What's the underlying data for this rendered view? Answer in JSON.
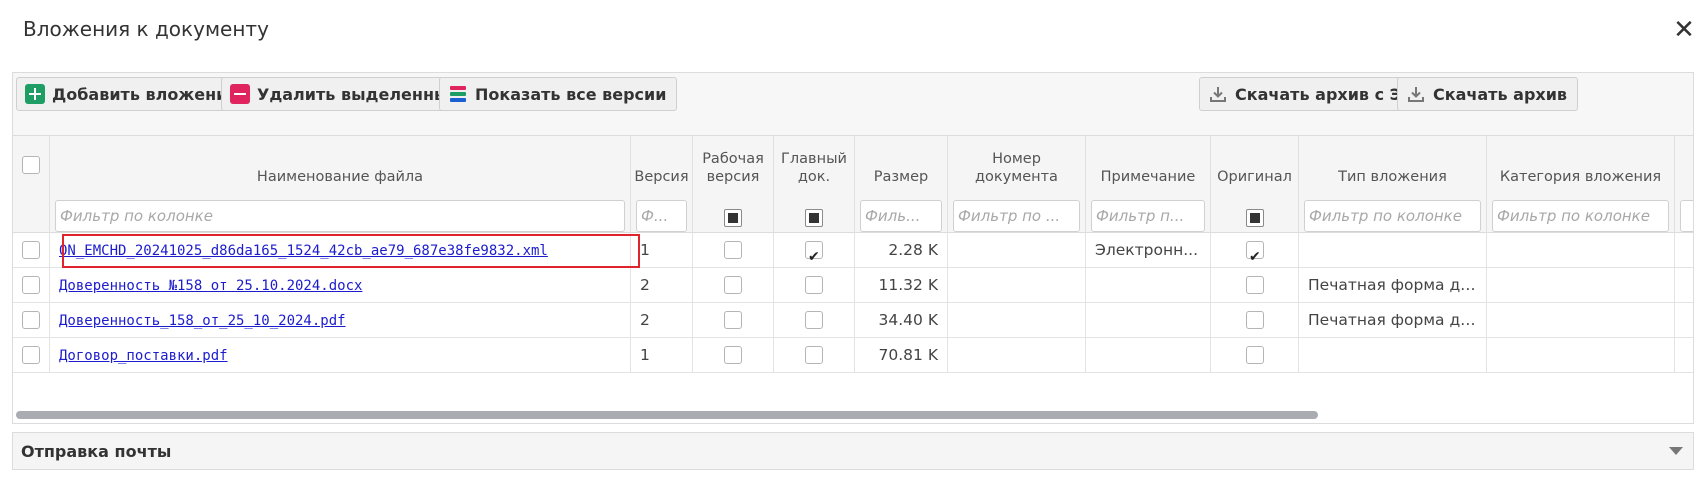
{
  "dialog": {
    "title": "Вложения к документу",
    "close_glyph": "✕"
  },
  "toolbar": {
    "add_label": "Добавить вложение",
    "delete_label": "Удалить выделенные",
    "versions_label": "Показать все версии",
    "download_sig_label": "Скачать архив с ЭП",
    "download_label": "Скачать архив",
    "icons": {
      "add": "plus-icon",
      "delete": "minus-icon",
      "versions": "stack-icon",
      "download": "download-icon"
    },
    "colors": {
      "add": "#1e9e64",
      "delete": "#e0245e",
      "stack": [
        "#e0245e",
        "#1e9e64",
        "#1c5fd1"
      ]
    }
  },
  "columns": [
    {
      "key": "select",
      "label": ""
    },
    {
      "key": "name",
      "label": "Наименование файла",
      "filter": "Фильтр по колонке"
    },
    {
      "key": "version",
      "label": "Версия",
      "filter": "Ф..."
    },
    {
      "key": "working",
      "label": "Рабочая версия",
      "filter_state": "indeterminate"
    },
    {
      "key": "main",
      "label": "Главный док.",
      "filter_state": "indeterminate"
    },
    {
      "key": "size",
      "label": "Размер",
      "filter": "Филь..."
    },
    {
      "key": "docnum",
      "label": "Номер документа",
      "filter": "Фильтр по ..."
    },
    {
      "key": "note",
      "label": "Примечание",
      "filter": "Фильтр п..."
    },
    {
      "key": "original",
      "label": "Оригинал",
      "filter_state": "indeterminate"
    },
    {
      "key": "type",
      "label": "Тип вложения",
      "filter": "Фильтр по колонке"
    },
    {
      "key": "category",
      "label": "Категория вложения",
      "filter": "Фильтр по колонке"
    }
  ],
  "rows": [
    {
      "name": "ON_EMCHD_20241025_d86da165_1524_42cb_ae79_687e38fe9832.xml",
      "version": "1",
      "working": false,
      "main": true,
      "size": "2.28 K",
      "docnum": "",
      "note": "Электронн...",
      "original": true,
      "type": "",
      "category": ""
    },
    {
      "name": "Доверенность №158 от 25.10.2024.docx",
      "version": "2",
      "working": false,
      "main": false,
      "size": "11.32 K",
      "docnum": "",
      "note": "",
      "original": false,
      "type": "Печатная форма до...",
      "category": ""
    },
    {
      "name": "Доверенность_158_от_25_10_2024.pdf",
      "version": "2",
      "working": false,
      "main": false,
      "size": "34.40 K",
      "docnum": "",
      "note": "",
      "original": false,
      "type": "Печатная форма до...",
      "category": ""
    },
    {
      "name": "Договор_поставки.pdf",
      "version": "1",
      "working": false,
      "main": false,
      "size": "70.81 K",
      "docnum": "",
      "note": "",
      "original": false,
      "type": "",
      "category": ""
    }
  ],
  "mail": {
    "title": "Отправка почты",
    "toggle_icon": "chevron-down-icon"
  },
  "highlight": {
    "color": "#e0242c",
    "row": 0
  }
}
